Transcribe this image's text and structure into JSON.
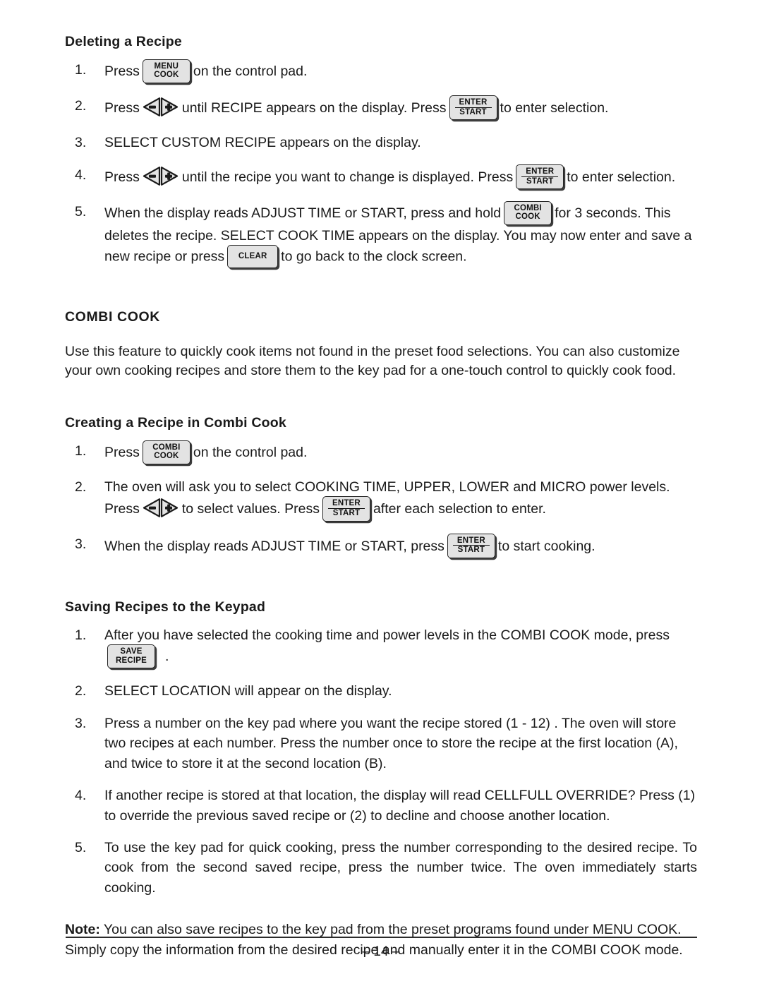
{
  "page": {
    "folio": "– 14 –"
  },
  "keys": {
    "menu_cook": {
      "line1": "MENU",
      "line2": "COOK",
      "name": "menu-cook-key"
    },
    "combi_cook": {
      "line1": "COMBI",
      "line2": "COOK",
      "name": "combi-cook-key"
    },
    "enter_start": {
      "line1": "ENTER",
      "line2": "START",
      "name": "enter-start-key"
    },
    "clear": {
      "line1": "CLEAR",
      "name": "clear-key"
    },
    "save_recipe": {
      "line1": "SAVE",
      "line2": "RECIPE",
      "name": "save-recipe-key"
    },
    "minus": {
      "glyph": "–",
      "name": "minus-arrow-key"
    },
    "plus": {
      "glyph": "+",
      "name": "plus-arrow-key"
    }
  },
  "sections": {
    "deleting_recipe": {
      "heading": "Deleting a Recipe",
      "steps": {
        "s1": {
          "num": "1.",
          "a": "Press",
          "b": "on the control pad."
        },
        "s2": {
          "num": "2.",
          "a": "Press",
          "b": "until RECIPE appears on the display. Press",
          "c": "to enter selection."
        },
        "s3": {
          "num": "3.",
          "a": "SELECT CUSTOM RECIPE appears on the display."
        },
        "s4": {
          "num": "4.",
          "a": "Press",
          "b": "until the recipe you want to change is displayed. Press",
          "c": "to enter selection."
        },
        "s5": {
          "num": "5.",
          "a": "When the display reads ADJUST TIME or START, press and hold",
          "b": "for 3 seconds. This deletes the recipe. SELECT COOK TIME appears on the display. You may now enter and save a new recipe or press",
          "c": "to go back to the clock screen."
        }
      }
    },
    "combi_cook": {
      "heading": "COMBI COOK",
      "intro": "Use this feature to quickly cook items not found in the preset food selections. You can also customize your own cooking recipes and store them to the key pad for a one-touch control to quickly cook food."
    },
    "creating_recipe": {
      "heading": "Creating a Recipe in Combi Cook",
      "steps": {
        "s1": {
          "num": "1.",
          "a": "Press",
          "b": "on the control pad."
        },
        "s2": {
          "num": "2.",
          "a": "The oven will ask you to select COOKING TIME, UPPER, LOWER and MICRO power levels. Press",
          "b": "to select values. Press",
          "c": "after each selection to enter."
        },
        "s3": {
          "num": "3.",
          "a": "When the display reads ADJUST TIME or START, press",
          "b": "to start cooking."
        }
      }
    },
    "saving_recipes": {
      "heading": "Saving Recipes to the Keypad",
      "steps": {
        "s1": {
          "num": "1.",
          "a": "After you have selected the cooking time and power levels in the COMBI COOK mode, press",
          "b": "."
        },
        "s2": {
          "num": "2.",
          "a": "SELECT LOCATION will appear on the display."
        },
        "s3": {
          "num": "3.",
          "a": "Press a number on the key pad where you want the recipe stored (1 - 12) . The oven will store two recipes at each number. Press the number once to store the recipe at the first location (A), and twice to store it at the second location (B)."
        },
        "s4": {
          "num": "4.",
          "a": "If another recipe is  stored at that  location, the display will read  CELLFULL OVERRIDE? Press (1) to override the previous saved recipe or (2) to decline and choose another location."
        },
        "s5": {
          "num": "5.",
          "a": "To use the key pad for quick cooking, press the number corresponding to the desired recipe. To cook from the second saved recipe, press the number twice. The oven immediately starts cooking."
        }
      },
      "note_label": "Note:",
      "note_text": " You can also save recipes to the key pad from the preset programs found under MENU COOK. Simply copy the information from the desired recipe and manually enter it in the COMBI COOK mode."
    }
  }
}
